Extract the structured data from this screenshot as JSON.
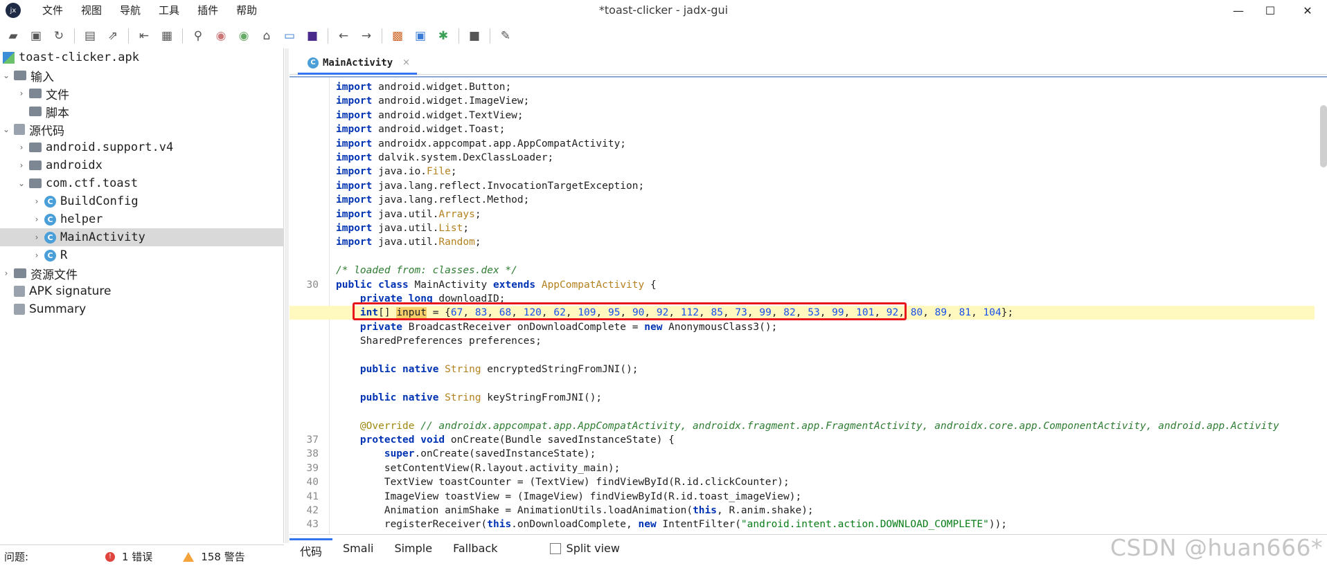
{
  "window": {
    "title": "*toast-clicker - jadx-gui",
    "logo_glyph": "jx",
    "minimize_glyph": "—",
    "maximize_glyph": "☐",
    "close_glyph": "✕"
  },
  "menu": [
    "文件",
    "视图",
    "导航",
    "工具",
    "插件",
    "帮助"
  ],
  "toolbar_icons": [
    "open-icon",
    "add-file-icon",
    "refresh-icon",
    "save-icon",
    "export-icon",
    "sync-icon",
    "flatten-icon",
    "search-icon",
    "find-class-icon",
    "find-usage-icon",
    "home-icon",
    "log-icon",
    "plugin-icon",
    "back-icon",
    "forward-icon",
    "decompile-icon",
    "quark-icon",
    "debug-icon",
    "stop-icon",
    "settings-icon"
  ],
  "tree": {
    "root": "toast-clicker.apk",
    "inputs": "输入",
    "files": "文件",
    "scripts": "脚本",
    "source": "源代码",
    "pkg_support": "android.support.v4",
    "pkg_androidx": "androidx",
    "pkg_toast": "com.ctf.toast",
    "cls_buildconfig": "BuildConfig",
    "cls_helper": "helper",
    "cls_main": "MainActivity",
    "cls_r": "R",
    "resources": "资源文件",
    "apk_sig": "APK signature",
    "summary": "Summary"
  },
  "editor": {
    "tab_label": "MainActivity",
    "tab_close": "×",
    "class_icon_letter": "C"
  },
  "code_lines": [
    {
      "no": "",
      "text": "import android.widget.Button;"
    },
    {
      "no": "",
      "text": "import android.widget.ImageView;"
    },
    {
      "no": "",
      "text": "import android.widget.TextView;"
    },
    {
      "no": "",
      "text": "import android.widget.Toast;"
    },
    {
      "no": "",
      "text": "import androidx.appcompat.app.AppCompatActivity;"
    },
    {
      "no": "",
      "text": "import dalvik.system.DexClassLoader;"
    },
    {
      "no": "",
      "text": "import java.io.File;"
    },
    {
      "no": "",
      "text": "import java.lang.reflect.InvocationTargetException;"
    },
    {
      "no": "",
      "text": "import java.lang.reflect.Method;"
    },
    {
      "no": "",
      "text": "import java.util.Arrays;"
    },
    {
      "no": "",
      "text": "import java.util.List;"
    },
    {
      "no": "",
      "text": "import java.util.Random;"
    },
    {
      "no": "",
      "text": ""
    },
    {
      "no": "",
      "text": "/* loaded from: classes.dex */"
    },
    {
      "no": "30",
      "text": "public class MainActivity extends AppCompatActivity {"
    },
    {
      "no": "",
      "text": "    private long downloadID;"
    },
    {
      "no": "",
      "text": "    int[] input = {67, 83, 68, 120, 62, 109, 95, 90, 92, 112, 85, 73, 99, 82, 53, 99, 101, 92, 80, 89, 81, 104};"
    },
    {
      "no": "",
      "text": "    private BroadcastReceiver onDownloadComplete = new AnonymousClass3();"
    },
    {
      "no": "",
      "text": "    SharedPreferences preferences;"
    },
    {
      "no": "",
      "text": ""
    },
    {
      "no": "",
      "text": "    public native String encryptedStringFromJNI();"
    },
    {
      "no": "",
      "text": ""
    },
    {
      "no": "",
      "text": "    public native String keyStringFromJNI();"
    },
    {
      "no": "",
      "text": ""
    },
    {
      "no": "",
      "text": "    @Override // androidx.appcompat.app.AppCompatActivity, androidx.fragment.app.FragmentActivity, androidx.core.app.ComponentActivity, android.app.Activity"
    },
    {
      "no": "37",
      "text": "    protected void onCreate(Bundle savedInstanceState) {"
    },
    {
      "no": "38",
      "text": "        super.onCreate(savedInstanceState);"
    },
    {
      "no": "39",
      "text": "        setContentView(R.layout.activity_main);"
    },
    {
      "no": "40",
      "text": "        TextView toastCounter = (TextView) findViewById(R.id.clickCounter);"
    },
    {
      "no": "41",
      "text": "        ImageView toastView = (ImageView) findViewById(R.id.toast_imageView);"
    },
    {
      "no": "42",
      "text": "        Animation animShake = AnimationUtils.loadAnimation(this, R.anim.shake);"
    },
    {
      "no": "43",
      "text": "        registerReceiver(this.onDownloadComplete, new IntentFilter(\"android.intent.action.DOWNLOAD_COMPLETE\"));"
    }
  ],
  "view_tabs": [
    "代码",
    "Smali",
    "Simple",
    "Fallback"
  ],
  "split_view_label": "Split view",
  "status": {
    "label": "问题:",
    "errors": "1 错误",
    "warnings": "158 警告"
  },
  "watermark": "CSDN @huan666*",
  "colors": {
    "keyword": "#0033b3",
    "highlight_line": "#fff9c0",
    "annotation_box": "#e8151b",
    "accent": "#3574f0"
  }
}
